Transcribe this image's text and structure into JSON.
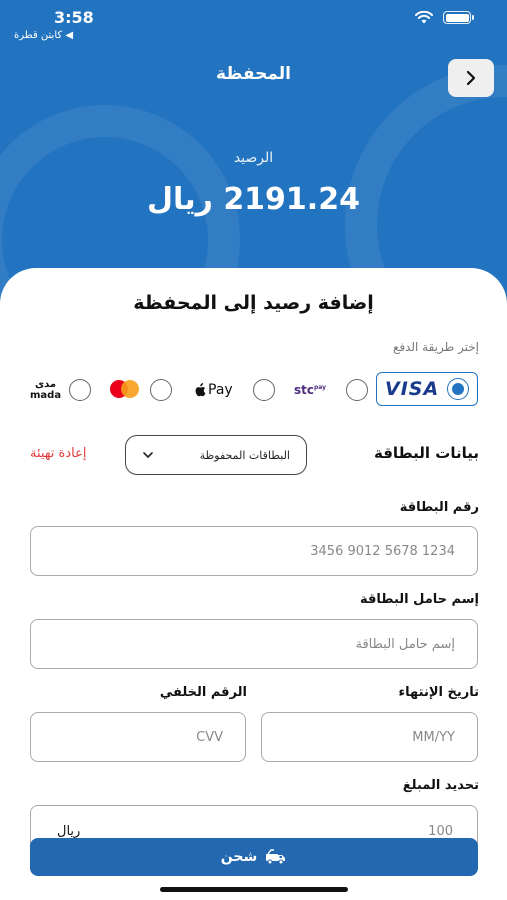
{
  "status_bar": {
    "time": "3:58",
    "back_app": "◀ كابتن قطرة"
  },
  "nav": {
    "title": "المحفظة"
  },
  "balance": {
    "label": "الرصيد",
    "value": "2191.24 ريال"
  },
  "form": {
    "title": "إضافة رصيد إلى المحفظة",
    "payment_method_label": "إختر طريقة الدفع",
    "payment_methods": [
      {
        "name": "VISA",
        "selected": true
      },
      {
        "name": "stc pay",
        "text": "stc",
        "sub": "pay",
        "selected": false
      },
      {
        "name": "Apple Pay",
        "text": "Pay",
        "selected": false
      },
      {
        "name": "mastercard",
        "selected": false
      },
      {
        "name": "mada",
        "line1": "مدى",
        "line2": "mada",
        "selected": false
      }
    ],
    "card_data_label": "بيانات البطاقة",
    "saved_cards_label": "البطاقات المحفوظة",
    "reset_label": "إعادة تهيئة",
    "card_number_label": "رقم البطاقة",
    "card_number_placeholder": "3456 9012 5678 1234",
    "holder_label": "إسم حامل البطاقة",
    "holder_placeholder": "إسم حامل البطاقة",
    "expiry_label": "تاريخ الإنتهاء",
    "expiry_placeholder": "MM/YY",
    "cvv_label": "الرقم الخلفي",
    "cvv_placeholder": "CVV",
    "amount_label": "تحديد المبلغ",
    "amount_value": "100",
    "amount_unit": "ريال",
    "charge_button": "شحن"
  },
  "colors": {
    "primary": "#2374c0",
    "button": "#2468b1",
    "reset": "#e23b3b"
  }
}
